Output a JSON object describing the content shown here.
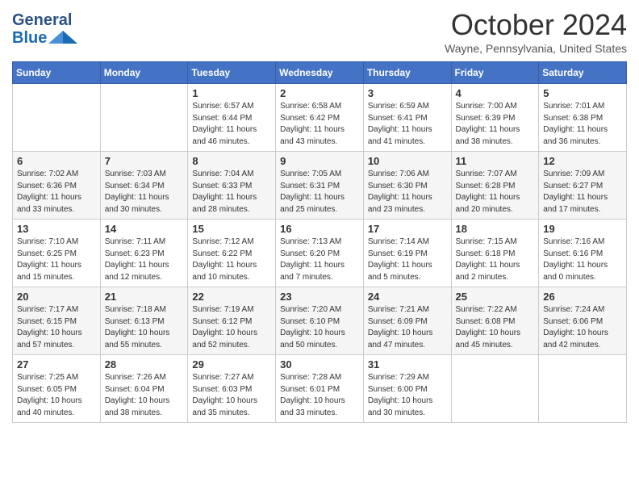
{
  "header": {
    "logo_general": "General",
    "logo_blue": "Blue",
    "month": "October 2024",
    "location": "Wayne, Pennsylvania, United States"
  },
  "days_of_week": [
    "Sunday",
    "Monday",
    "Tuesday",
    "Wednesday",
    "Thursday",
    "Friday",
    "Saturday"
  ],
  "weeks": [
    [
      {
        "day": "",
        "sunrise": "",
        "sunset": "",
        "daylight": ""
      },
      {
        "day": "",
        "sunrise": "",
        "sunset": "",
        "daylight": ""
      },
      {
        "day": "1",
        "sunrise": "Sunrise: 6:57 AM",
        "sunset": "Sunset: 6:44 PM",
        "daylight": "Daylight: 11 hours and 46 minutes."
      },
      {
        "day": "2",
        "sunrise": "Sunrise: 6:58 AM",
        "sunset": "Sunset: 6:42 PM",
        "daylight": "Daylight: 11 hours and 43 minutes."
      },
      {
        "day": "3",
        "sunrise": "Sunrise: 6:59 AM",
        "sunset": "Sunset: 6:41 PM",
        "daylight": "Daylight: 11 hours and 41 minutes."
      },
      {
        "day": "4",
        "sunrise": "Sunrise: 7:00 AM",
        "sunset": "Sunset: 6:39 PM",
        "daylight": "Daylight: 11 hours and 38 minutes."
      },
      {
        "day": "5",
        "sunrise": "Sunrise: 7:01 AM",
        "sunset": "Sunset: 6:38 PM",
        "daylight": "Daylight: 11 hours and 36 minutes."
      }
    ],
    [
      {
        "day": "6",
        "sunrise": "Sunrise: 7:02 AM",
        "sunset": "Sunset: 6:36 PM",
        "daylight": "Daylight: 11 hours and 33 minutes."
      },
      {
        "day": "7",
        "sunrise": "Sunrise: 7:03 AM",
        "sunset": "Sunset: 6:34 PM",
        "daylight": "Daylight: 11 hours and 30 minutes."
      },
      {
        "day": "8",
        "sunrise": "Sunrise: 7:04 AM",
        "sunset": "Sunset: 6:33 PM",
        "daylight": "Daylight: 11 hours and 28 minutes."
      },
      {
        "day": "9",
        "sunrise": "Sunrise: 7:05 AM",
        "sunset": "Sunset: 6:31 PM",
        "daylight": "Daylight: 11 hours and 25 minutes."
      },
      {
        "day": "10",
        "sunrise": "Sunrise: 7:06 AM",
        "sunset": "Sunset: 6:30 PM",
        "daylight": "Daylight: 11 hours and 23 minutes."
      },
      {
        "day": "11",
        "sunrise": "Sunrise: 7:07 AM",
        "sunset": "Sunset: 6:28 PM",
        "daylight": "Daylight: 11 hours and 20 minutes."
      },
      {
        "day": "12",
        "sunrise": "Sunrise: 7:09 AM",
        "sunset": "Sunset: 6:27 PM",
        "daylight": "Daylight: 11 hours and 17 minutes."
      }
    ],
    [
      {
        "day": "13",
        "sunrise": "Sunrise: 7:10 AM",
        "sunset": "Sunset: 6:25 PM",
        "daylight": "Daylight: 11 hours and 15 minutes."
      },
      {
        "day": "14",
        "sunrise": "Sunrise: 7:11 AM",
        "sunset": "Sunset: 6:23 PM",
        "daylight": "Daylight: 11 hours and 12 minutes."
      },
      {
        "day": "15",
        "sunrise": "Sunrise: 7:12 AM",
        "sunset": "Sunset: 6:22 PM",
        "daylight": "Daylight: 11 hours and 10 minutes."
      },
      {
        "day": "16",
        "sunrise": "Sunrise: 7:13 AM",
        "sunset": "Sunset: 6:20 PM",
        "daylight": "Daylight: 11 hours and 7 minutes."
      },
      {
        "day": "17",
        "sunrise": "Sunrise: 7:14 AM",
        "sunset": "Sunset: 6:19 PM",
        "daylight": "Daylight: 11 hours and 5 minutes."
      },
      {
        "day": "18",
        "sunrise": "Sunrise: 7:15 AM",
        "sunset": "Sunset: 6:18 PM",
        "daylight": "Daylight: 11 hours and 2 minutes."
      },
      {
        "day": "19",
        "sunrise": "Sunrise: 7:16 AM",
        "sunset": "Sunset: 6:16 PM",
        "daylight": "Daylight: 11 hours and 0 minutes."
      }
    ],
    [
      {
        "day": "20",
        "sunrise": "Sunrise: 7:17 AM",
        "sunset": "Sunset: 6:15 PM",
        "daylight": "Daylight: 10 hours and 57 minutes."
      },
      {
        "day": "21",
        "sunrise": "Sunrise: 7:18 AM",
        "sunset": "Sunset: 6:13 PM",
        "daylight": "Daylight: 10 hours and 55 minutes."
      },
      {
        "day": "22",
        "sunrise": "Sunrise: 7:19 AM",
        "sunset": "Sunset: 6:12 PM",
        "daylight": "Daylight: 10 hours and 52 minutes."
      },
      {
        "day": "23",
        "sunrise": "Sunrise: 7:20 AM",
        "sunset": "Sunset: 6:10 PM",
        "daylight": "Daylight: 10 hours and 50 minutes."
      },
      {
        "day": "24",
        "sunrise": "Sunrise: 7:21 AM",
        "sunset": "Sunset: 6:09 PM",
        "daylight": "Daylight: 10 hours and 47 minutes."
      },
      {
        "day": "25",
        "sunrise": "Sunrise: 7:22 AM",
        "sunset": "Sunset: 6:08 PM",
        "daylight": "Daylight: 10 hours and 45 minutes."
      },
      {
        "day": "26",
        "sunrise": "Sunrise: 7:24 AM",
        "sunset": "Sunset: 6:06 PM",
        "daylight": "Daylight: 10 hours and 42 minutes."
      }
    ],
    [
      {
        "day": "27",
        "sunrise": "Sunrise: 7:25 AM",
        "sunset": "Sunset: 6:05 PM",
        "daylight": "Daylight: 10 hours and 40 minutes."
      },
      {
        "day": "28",
        "sunrise": "Sunrise: 7:26 AM",
        "sunset": "Sunset: 6:04 PM",
        "daylight": "Daylight: 10 hours and 38 minutes."
      },
      {
        "day": "29",
        "sunrise": "Sunrise: 7:27 AM",
        "sunset": "Sunset: 6:03 PM",
        "daylight": "Daylight: 10 hours and 35 minutes."
      },
      {
        "day": "30",
        "sunrise": "Sunrise: 7:28 AM",
        "sunset": "Sunset: 6:01 PM",
        "daylight": "Daylight: 10 hours and 33 minutes."
      },
      {
        "day": "31",
        "sunrise": "Sunrise: 7:29 AM",
        "sunset": "Sunset: 6:00 PM",
        "daylight": "Daylight: 10 hours and 30 minutes."
      },
      {
        "day": "",
        "sunrise": "",
        "sunset": "",
        "daylight": ""
      },
      {
        "day": "",
        "sunrise": "",
        "sunset": "",
        "daylight": ""
      }
    ]
  ]
}
